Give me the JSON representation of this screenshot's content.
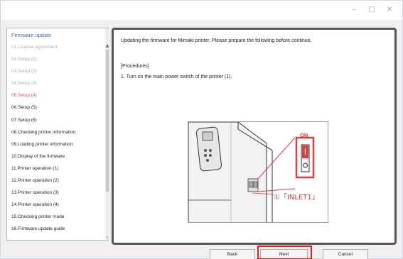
{
  "window": {
    "min_glyph": "–",
    "max_glyph": "□",
    "close_glyph": "✕"
  },
  "sidebar": {
    "title": "Firmware update",
    "up_arrow": "▲",
    "down_arrow": "⌄",
    "steps": [
      {
        "label": "01.License Agreement",
        "state": "done"
      },
      {
        "label": "02.Setup (1)",
        "state": "done"
      },
      {
        "label": "03.Setup (2)",
        "state": "done"
      },
      {
        "label": "04.Setup (3)",
        "state": "done"
      },
      {
        "label": "05.Setup (4)",
        "state": "current"
      },
      {
        "label": "06.Setup (5)",
        "state": "pending"
      },
      {
        "label": "07.Setup (6)",
        "state": "pending"
      },
      {
        "label": "08.Checking printer information",
        "state": "pending"
      },
      {
        "label": "09.Loading printer information",
        "state": "pending"
      },
      {
        "label": "10.Display of the firmware",
        "state": "pending"
      },
      {
        "label": "11.Printer operation (1)",
        "state": "pending"
      },
      {
        "label": "12.Printer operation (2)",
        "state": "pending"
      },
      {
        "label": "13.Printer operation (3)",
        "state": "pending"
      },
      {
        "label": "14.Printer operation (4)",
        "state": "pending"
      },
      {
        "label": "15.Checking printer mode",
        "state": "pending"
      },
      {
        "label": "16.Firmware update guide",
        "state": "pending"
      }
    ]
  },
  "content": {
    "intro": "Updating the firmware for Mimaki printer. Please prepare the following before continue.",
    "procedures_heading": "[Procedures]",
    "step_1": "1.  Turn on the main power switch of the printer (1).",
    "illustration": {
      "on_label": "ON",
      "inlet_label": "①「INLET1」"
    }
  },
  "footer": {
    "back_label": "Back",
    "next_label": "Next",
    "cancel_label": "Cancel"
  },
  "colors": {
    "accent": "#3c6fb3",
    "current_step": "#e05555",
    "highlight": "#e02020"
  }
}
